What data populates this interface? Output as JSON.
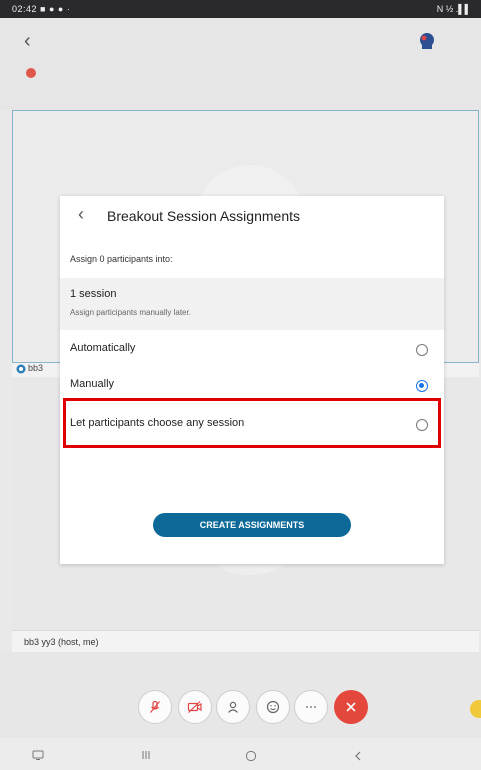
{
  "status_bar": {
    "time": "02:42",
    "left_icons": "■ ● ● ·",
    "right_icons": "N ½ .▌▌"
  },
  "tiles": {
    "tile1_label": "bb3",
    "tile2_label": "bb3 yy3 (host, me)"
  },
  "dialog": {
    "title": "Breakout Session Assignments",
    "assign_label": "Assign 0 participants into:",
    "session_count": "1 session",
    "session_hint": "Assign participants manually later.",
    "options": [
      {
        "label": "Automatically",
        "selected": false
      },
      {
        "label": "Manually",
        "selected": true
      },
      {
        "label": "Let participants choose any session",
        "selected": false
      }
    ],
    "create_button": "CREATE ASSIGNMENTS"
  },
  "colors": {
    "accent": "#0d6a98",
    "radio_selected": "#1a73e8",
    "highlight": "#e00000",
    "end_call": "#e4473b"
  }
}
